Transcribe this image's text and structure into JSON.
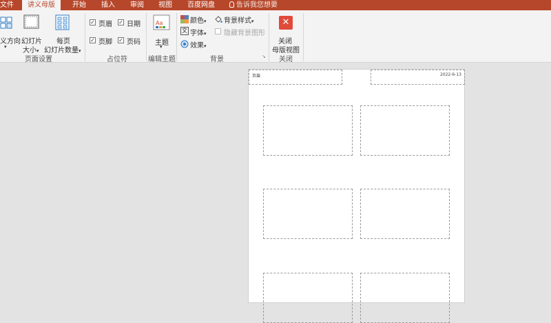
{
  "tabs": [
    {
      "label": "文件",
      "active": false
    },
    {
      "label": "讲义母版",
      "active": true
    },
    {
      "label": "开始",
      "active": false
    },
    {
      "label": "插入",
      "active": false
    },
    {
      "label": "审阅",
      "active": false
    },
    {
      "label": "视图",
      "active": false
    },
    {
      "label": "百度网盘",
      "active": false
    }
  ],
  "tell_me": "告诉我您想要",
  "ribbon": {
    "page_setup": {
      "group_label": "页面设置",
      "orientation_label": "义方向",
      "slide_size_label_1": "幻灯片",
      "slide_size_label_2": "大小",
      "per_page_label_1": "每页",
      "per_page_label_2": "幻灯片数量"
    },
    "placeholders": {
      "group_label": "占位符",
      "header": {
        "label": "页眉",
        "checked": true
      },
      "date": {
        "label": "日期",
        "checked": true
      },
      "footer": {
        "label": "页脚",
        "checked": true
      },
      "page_number": {
        "label": "页码",
        "checked": true
      }
    },
    "edit_theme": {
      "group_label": "编辑主题",
      "theme_label": "主题"
    },
    "background": {
      "group_label": "背景",
      "colors_label": "颜色",
      "fonts_label": "字体",
      "effects_label": "效果",
      "bg_styles_label": "背景样式",
      "hide_bg_label": "隐藏背景图形"
    },
    "close": {
      "group_label": "关闭",
      "close_label_1": "关闭",
      "close_label_2": "母版视图"
    }
  },
  "slide": {
    "header_text": "页眉",
    "date_text": "2022-6-13"
  },
  "colors": {
    "accent": "#b7472a",
    "ribbon_bg": "#f3f3f3",
    "workspace_bg": "#e3e3e3",
    "close_red": "#e04a3a"
  }
}
